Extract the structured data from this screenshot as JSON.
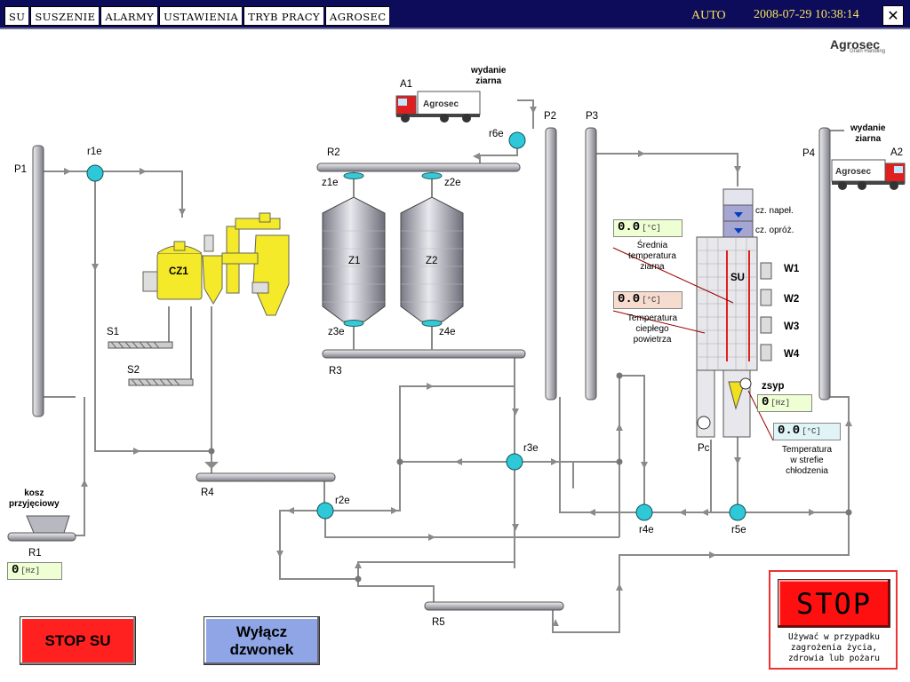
{
  "nav": {
    "tabs": [
      "SU",
      "SUSZENIE",
      "ALARMY",
      "USTAWIENIA",
      "TRYB PRACY",
      "AGROSEC"
    ],
    "close": "✕"
  },
  "status": {
    "mode": "AUTO",
    "datetime": "2008-07-29 10:38:14"
  },
  "logo": {
    "name": "Agrosec",
    "sub": "Grain Handling"
  },
  "labels": {
    "P1": "P1",
    "P2": "P2",
    "P3": "P3",
    "P4": "P4",
    "r1e": "r1e",
    "r2e": "r2e",
    "r3e": "r3e",
    "r4e": "r4e",
    "r5e": "r5e",
    "r6e": "r6e",
    "R1": "R1",
    "R2": "R2",
    "R3": "R3",
    "R4": "R4",
    "R5": "R5",
    "S1": "S1",
    "S2": "S2",
    "CZ1": "CZ1",
    "Z1": "Z1",
    "Z2": "Z2",
    "z1e": "z1e",
    "z2e": "z2e",
    "z3e": "z3e",
    "z4e": "z4e",
    "A1": "A1",
    "A2": "A2",
    "SU": "SU",
    "Pc": "Pc",
    "zsyp": "zsyp",
    "W1": "W1",
    "W2": "W2",
    "W3": "W3",
    "W4": "W4",
    "wydanie1": "wydanie\nziarna",
    "wydanie2": "wydanie\nziarna",
    "kosz": "kosz\nprzyjęciowy",
    "cz_napel": "cz. napeł.",
    "cz_oproz": "cz. opróż."
  },
  "readouts": {
    "grain_temp": {
      "value": "0.0",
      "unit": "[°C]",
      "label": "Średnia\ntemperatura\nziarna"
    },
    "air_temp": {
      "value": "0.0",
      "unit": "[°C]",
      "label": "Temperatura\nciepłego\npowietrza"
    },
    "zsyp_freq": {
      "value": "0",
      "unit": "[Hz]"
    },
    "cooling_temp": {
      "value": "0.0",
      "unit": "[°C]",
      "label": "Temperatura\nw strefie\nchłodzenia"
    },
    "r1_freq": {
      "value": "0",
      "unit": "[Hz]"
    }
  },
  "buttons": {
    "stop_su": "STOP SU",
    "bell": "Wyłącz\ndzwonek",
    "stop": "STOP"
  },
  "stop_note": "Używać w przypadku\nzagrożenia życia,\nzdrowia lub pożaru",
  "colors": {
    "topbar": "#0c0c5a",
    "status_text": "#f4e25c",
    "pipe": "#8a8a8a",
    "valve": "#2fc8d8",
    "cleaner": "#f4ea2a",
    "stop": "#ff1010",
    "bell": "#8fa5e6"
  }
}
